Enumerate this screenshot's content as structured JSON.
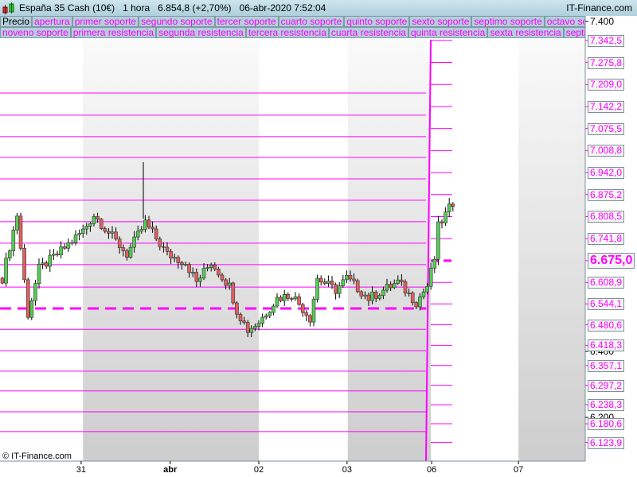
{
  "header": {
    "title": "España 35 Cash (10€)",
    "timeframe": "1 hora",
    "price": "6.854,8 (+2,70%)",
    "datetime": "06-abr-2020 7:52:04",
    "brand": "IT-Finance.com"
  },
  "legend_row1": [
    "Precio",
    "apertura",
    "primer soporte",
    "segundo soporte",
    "tercer soporte",
    "cuarto soporte",
    "quinto soporte",
    "sexto soporte",
    "septimo soporte",
    "octavo soporte"
  ],
  "legend_row2": [
    "noveno soporte",
    "primera resistencia",
    "segunda resistencia",
    "tercera resistencia",
    "cuarta resistencia",
    "quinta resistencia",
    "sexta resistencia",
    "septima resistenci"
  ],
  "copyright": "© IT-Finance.com",
  "colors": {
    "level": "#ff00ff",
    "up": "#55cc55",
    "down": "#e06060"
  },
  "chart_data": {
    "type": "candlestick",
    "y_ticks": [
      "7.400",
      "6.400",
      "6.200"
    ],
    "y_tick_values": [
      7400,
      6400,
      6200
    ],
    "ylim": [
      5850,
      7450
    ],
    "x_labels": [
      {
        "label": "31",
        "idx": 21.5
      },
      {
        "label": "abr",
        "idx": 45.8
      },
      {
        "label": "02",
        "idx": 70
      },
      {
        "label": "03",
        "idx": 94.1
      },
      {
        "label": "06",
        "idx": 117.2
      },
      {
        "label": "07",
        "idx": 140.9
      }
    ],
    "shaded_idx": [
      [
        22,
        70
      ],
      [
        94.3,
        117
      ],
      [
        140.9,
        160
      ]
    ],
    "current_levels": [
      "7.342,5",
      "7.275,8",
      "7.209,0",
      "7.142,2",
      "7.075,5",
      "7.008,8",
      "6.942,0",
      "6.875,2",
      "6.808,5",
      "6.741,8",
      "6.675,0",
      "6.608,9",
      "6.544,1",
      "6.480,6",
      "6.418,3",
      "6.357,1",
      "6.297,2",
      "6.238,3",
      "6.180,6",
      "6.123,9"
    ],
    "current_level_values": [
      7342.5,
      7275.8,
      7209,
      7142.2,
      7075.5,
      7008.8,
      6942,
      6875.2,
      6808.5,
      6741.8,
      6675,
      6608.9,
      6544.1,
      6480.6,
      6418.3,
      6357.1,
      6297.2,
      6238.3,
      6180.6,
      6123.9
    ],
    "highlight_level": "6.675,0",
    "previous_level_values": [
      7183,
      7116,
      7051,
      6988,
      6923,
      6858,
      6793,
      6728,
      6663,
      6595,
      6530,
      6467,
      6402,
      6340,
      6280,
      6217,
      6157
    ],
    "previous_dashed_value": 6530,
    "close_keyframes": [
      [
        0,
        6622
      ],
      [
        4,
        6814
      ],
      [
        7,
        6513
      ],
      [
        10,
        6650
      ],
      [
        15,
        6694
      ],
      [
        22,
        6766
      ],
      [
        25,
        6814
      ],
      [
        34,
        6694
      ],
      [
        39,
        6790
      ],
      [
        45,
        6694
      ],
      [
        50,
        6670
      ],
      [
        53,
        6610
      ],
      [
        57,
        6670
      ],
      [
        62,
        6598
      ],
      [
        64,
        6525
      ],
      [
        67,
        6465
      ],
      [
        70,
        6489
      ],
      [
        75,
        6561
      ],
      [
        79,
        6573
      ],
      [
        84,
        6501
      ],
      [
        86,
        6622
      ],
      [
        91,
        6586
      ],
      [
        94,
        6622
      ],
      [
        100,
        6561
      ],
      [
        108,
        6610
      ],
      [
        113,
        6549
      ],
      [
        116,
        6598
      ],
      [
        118,
        6682
      ],
      [
        119,
        6778
      ],
      [
        123,
        6851
      ]
    ]
  }
}
